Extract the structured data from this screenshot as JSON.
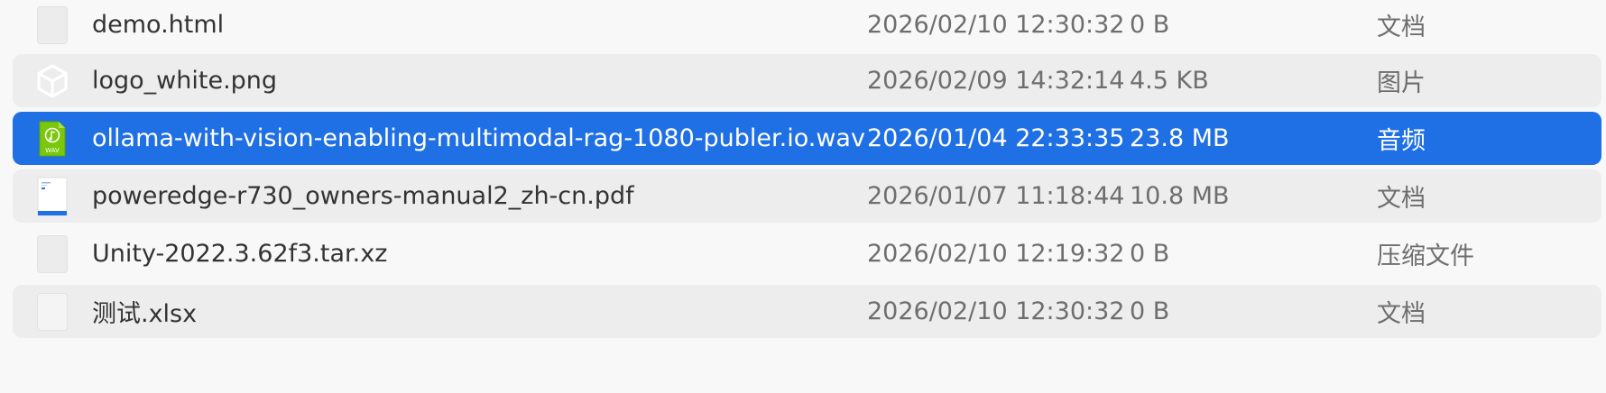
{
  "files": [
    {
      "name": "demo.html",
      "modified": "2026/02/10 12:30:32",
      "size": "0 B",
      "kind": "文档",
      "icon": "blank-file-icon"
    },
    {
      "name": "logo_white.png",
      "modified": "2026/02/09 14:32:14",
      "size": "4.5 KB",
      "kind": "图片",
      "icon": "image-cube-icon"
    },
    {
      "name": "ollama-with-vision-enabling-multimodal-rag-1080-publer.io.wav",
      "modified": "2026/01/04 22:33:35",
      "size": "23.8 MB",
      "kind": "音频",
      "icon": "wav-audio-icon",
      "icon_label": "WAV"
    },
    {
      "name": "poweredge-r730_owners-manual2_zh-cn.pdf",
      "modified": "2026/01/07 11:18:44",
      "size": "10.8 MB",
      "kind": "文档",
      "icon": "pdf-thumbnail-icon"
    },
    {
      "name": "Unity-2022.3.62f3.tar.xz",
      "modified": "2026/02/10 12:19:32",
      "size": "0 B",
      "kind": "压缩文件",
      "icon": "blank-file-icon"
    },
    {
      "name": "测试.xlsx",
      "modified": "2026/02/10 12:30:32",
      "size": "0 B",
      "kind": "文档",
      "icon": "blank-file-icon"
    }
  ],
  "colors": {
    "selection": "#1f6fe5",
    "stripe": "#ededed",
    "background": "#f8f8f8",
    "wav_icon": "#7ac70c"
  }
}
